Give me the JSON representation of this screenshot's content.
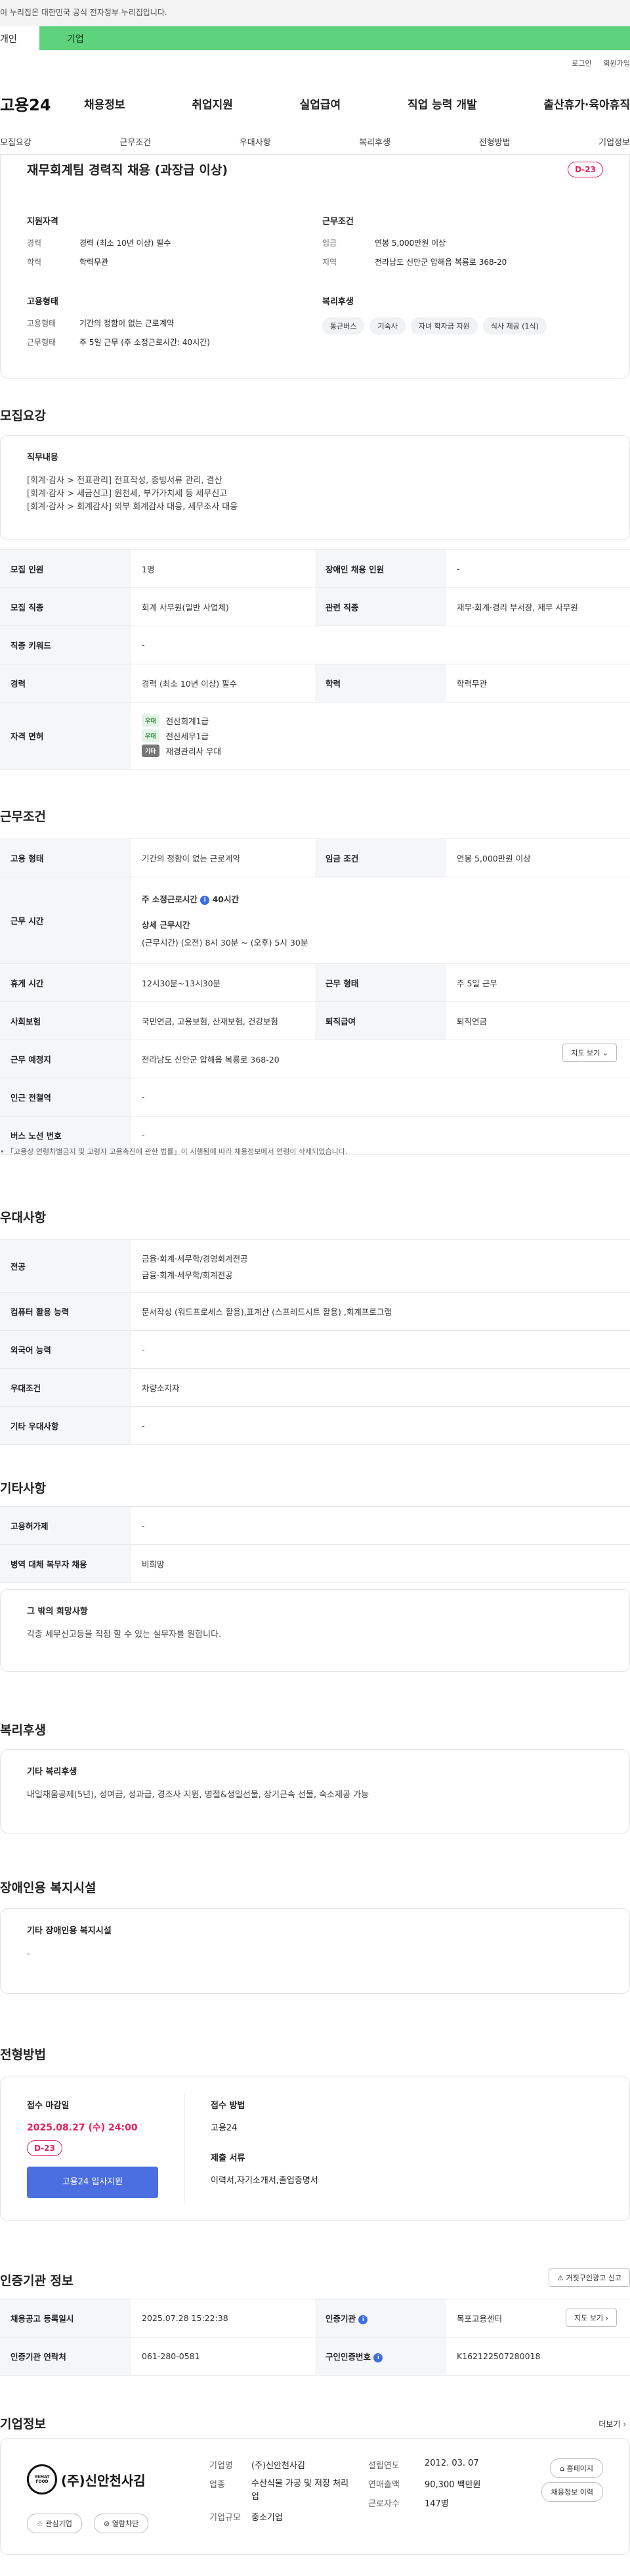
{
  "top_banner": "이 누리집은 대한민국 공식 전자정부 누리집입니다.",
  "user_tabs": {
    "personal": "개인",
    "corporate": "기업"
  },
  "util": {
    "login": "로그인",
    "join": "회원가입"
  },
  "logo": "고용24",
  "gnb": [
    "채용정보",
    "취업지원",
    "실업급여",
    "직업 능력 개발",
    "출산휴가·육아휴직"
  ],
  "tabs": [
    "모집요강",
    "근무조건",
    "우대사항",
    "복리후생",
    "전형방법",
    "기업정보"
  ],
  "summary": {
    "title": "재무회계팀 경력직 채용 (과장급 이상)",
    "dday": "D-23",
    "qual": {
      "title": "지원자격",
      "rows": [
        {
          "k": "경력",
          "v": "경력 (최소 10년 이상) 필수"
        },
        {
          "k": "학력",
          "v": "학력무관"
        }
      ]
    },
    "work": {
      "title": "근무조건",
      "rows": [
        {
          "k": "임금",
          "v": "연봉 5,000만원 이상"
        },
        {
          "k": "지역",
          "v": "전라남도 신안군 압해읍 복룡로 368-20"
        }
      ]
    },
    "emp": {
      "title": "고용형태",
      "rows": [
        {
          "k": "고용형태",
          "v": "기간의 정함이 없는 근로계약"
        },
        {
          "k": "근무형태",
          "v": "주 5일 근무 (주 소정근로시간: 40시간)"
        }
      ]
    },
    "welfare": {
      "title": "복리후생",
      "chips": [
        "통근버스",
        "기숙사",
        "자녀 학자금 지원",
        "식사 제공 (1식)"
      ]
    }
  },
  "recruit": {
    "title": "모집요강",
    "duty_title": "직무내용",
    "duty_lines": [
      "[회계·감사 > 전표관리] 전표작성, 증빙서류 관리, 결산",
      "[회계·감사 > 세금신고] 원천세, 부가가치세 등 세무신고",
      "[회계·감사 > 회계감사] 외부 회계감사 대응, 세무조사 대응"
    ],
    "rows": [
      {
        "k1": "모집 인원",
        "v1": "1명",
        "k2": "장애인 채용 인원",
        "v2": "-"
      },
      {
        "k1": "모집 직종",
        "v1": "회계 사무원(일반 사업체)",
        "k2": "관련 직종",
        "v2": "재무·회계·경리 부서장, 재무 사무원"
      },
      {
        "k1": "직종 키워드",
        "v1": "-"
      },
      {
        "k1": "경력",
        "v1": "경력 (최소 10년 이상) 필수",
        "k2": "학력",
        "v2": "학력무관"
      }
    ],
    "lic_label": "자격 면허",
    "licenses": [
      {
        "tag": "우대",
        "name": "전산회계1급"
      },
      {
        "tag": "우대",
        "name": "전산세무1급"
      },
      {
        "tag": "기타",
        "name": "재경관리사 우대"
      }
    ]
  },
  "work": {
    "title": "근무조건",
    "r1": {
      "k1": "고용 형태",
      "v1": "기간의 정함이 없는 근로계약",
      "k2": "임금 조건",
      "v2": "연봉 5,000만원 이상"
    },
    "hours": {
      "k": "근무 시간",
      "week_label": "주 소정근로시간",
      "week_val": "40시간",
      "detail_label": "상세 근무시간",
      "detail_val": "(근무시간) (오전) 8시 30분 ~ (오후) 5시 30분"
    },
    "r3": {
      "k1": "휴게 시간",
      "v1": "12시30분~13시30분",
      "k2": "근무 형태",
      "v2": "주 5일 근무"
    },
    "r4": {
      "k1": "사회보험",
      "v1": "국민연금, 고용보험, 산재보험, 건강보험",
      "k2": "퇴직급여",
      "v2": "퇴직연금"
    },
    "r5": {
      "k": "근무 예정지",
      "v": "전라남도 신안군 압해읍 복룡로 368-20",
      "btn": "지도 보기"
    },
    "r6": {
      "k": "인근 전철역",
      "v": "-"
    },
    "r7": {
      "k": "버스 노선 번호",
      "v": "-"
    },
    "note": "「고용상 연령차별금지 및 고령자 고용촉진에 관한 법률」이 시행됨에 따라 채용정보에서 연령이 삭제되었습니다."
  },
  "pref": {
    "title": "우대사항",
    "rows": [
      {
        "k": "전공",
        "v": [
          "금융·회계·세무학/경영회계전공",
          "금융·회계·세무학/회계전공"
        ]
      },
      {
        "k": "컴퓨터 활용 능력",
        "v": [
          "문서작성 (워드프로세스 활용),표계산 (스프레드시트 활용) ,회계프로그램"
        ]
      },
      {
        "k": "외국어 능력",
        "v": [
          "-"
        ]
      },
      {
        "k": "우대조건",
        "v": [
          "차량소지자"
        ]
      },
      {
        "k": "기타 우대사항",
        "v": [
          "-"
        ]
      }
    ]
  },
  "etc": {
    "title": "기타사항",
    "rows": [
      {
        "k": "고용허가제",
        "v": "-"
      },
      {
        "k": "병역 대체 복무자 채용",
        "v": "비희망"
      }
    ],
    "wish_title": "그 밖의 희망사항",
    "wish": "각종 세무신고등을 직접 할 수 있는 실무자를 원합니다."
  },
  "benefit": {
    "title": "복리후생",
    "sub": "기타 복리후생",
    "text": "내일채움공제(5년), 성여금, 성과급, 경조사 지원, 명절&생일선물, 장기근속 선물, 숙소제공 가능"
  },
  "disabled": {
    "title": "장애인용 복지시설",
    "sub": "기타 장애인용 복지시설",
    "text": "-"
  },
  "select": {
    "title": "전형방법",
    "deadline_label": "접수 마감일",
    "deadline": "2025.08.27 (수) 24:00",
    "dday": "D-23",
    "apply_btn": "고용24 입사지원",
    "method_label": "접수 방법",
    "method": "고용24",
    "docs_label": "제출 서류",
    "docs": "이력서,자기소개서,졸업증명서"
  },
  "cert": {
    "title": "인증기관 정보",
    "report_btn": "거짓구인광고 신고",
    "r1": {
      "k1": "채용공고 등록일시",
      "v1": "2025.07.28 15:22:38",
      "k2": "인증기관",
      "v2": "목포고용센터",
      "btn": "지도 보기"
    },
    "r2": {
      "k1": "인증기관 연락처",
      "v1": "061-280-0581",
      "k2": "구인인증번호",
      "v2": "K162122507280018"
    }
  },
  "company": {
    "title": "기업정보",
    "more": "더보기",
    "logo_text": "(주)신안천사김",
    "logo_small": "YEMAT FOOD",
    "fav": "관심기업",
    "block": "열람차단",
    "rows": [
      {
        "k": "기업명",
        "v": "(주)신안천사김",
        "k2": "설립연도",
        "v2": "2012. 03. 07"
      },
      {
        "k": "업종",
        "v": "수산식물 가공 및 저장 처리업",
        "k2": "연매출액",
        "v2": "90,300 백만원"
      },
      {
        "k": "기업규모",
        "v": "중소기업",
        "k2": "근로자수",
        "v2": "147명"
      }
    ],
    "homepage": "홈페이지",
    "history": "채용정보 이력"
  },
  "colors": {
    "green": "#5ed27d",
    "accent": "#e61f5b",
    "blue": "#4b6ee0"
  }
}
